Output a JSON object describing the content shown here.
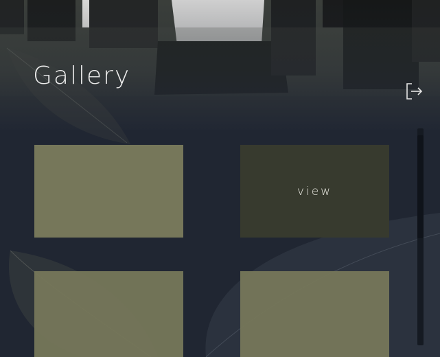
{
  "header": {
    "title": "Gallery"
  },
  "actions": {
    "logout_icon": "logout-icon"
  },
  "gallery": {
    "tiles": [
      {
        "label": "",
        "state": "default"
      },
      {
        "label": "view",
        "state": "hover"
      },
      {
        "label": "",
        "state": "default"
      },
      {
        "label": "",
        "state": "default"
      }
    ]
  },
  "scrollbar": {
    "position": 0.05
  },
  "colors": {
    "background": "#212733",
    "tile": "#76775a",
    "tile_hover": "#373a2e",
    "text": "#ececec"
  }
}
